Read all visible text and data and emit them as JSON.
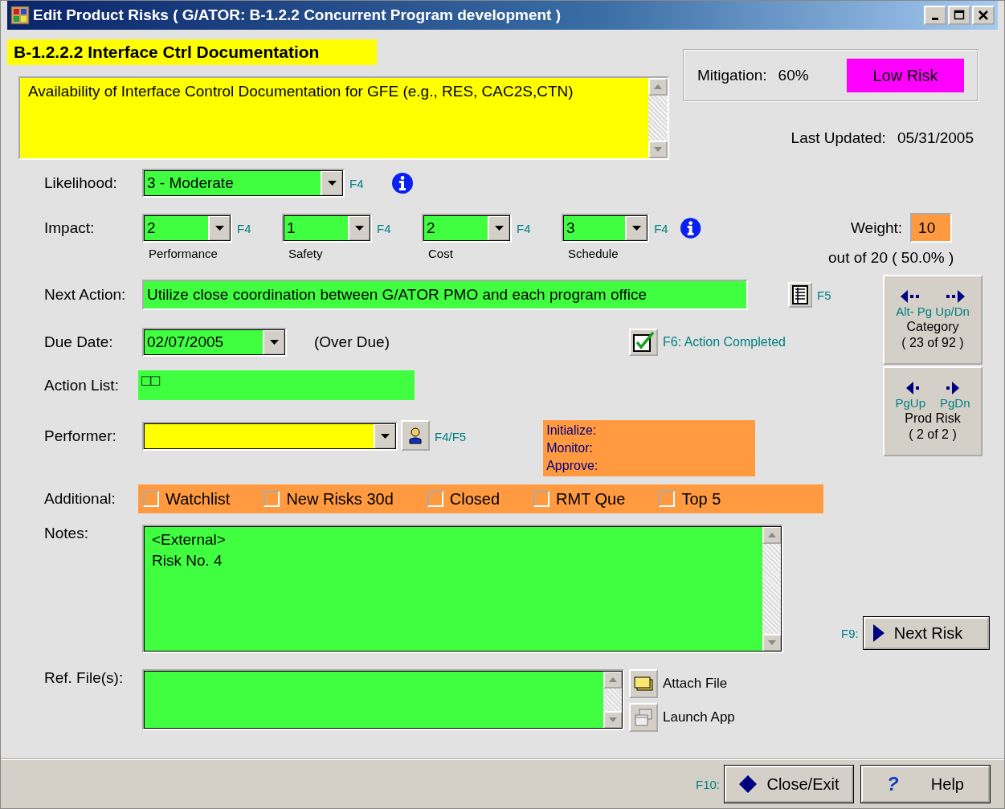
{
  "window": {
    "title": "Edit Product Risks  ( G/ATOR:  B-1.2.2 Concurrent Program development )"
  },
  "heading": "B-1.2.2.2 Interface Ctrl Documentation",
  "description": "Availability of Interface Control Documentation for GFE (e.g., RES, CAC2S,CTN)",
  "mitigation": {
    "label": "Mitigation:",
    "value": "60%",
    "risk": "Low Risk"
  },
  "last_updated": {
    "label": "Last Updated:",
    "value": "05/31/2005"
  },
  "likelihood": {
    "label": "Likelihood:",
    "value": "3 - Moderate",
    "key": "F4"
  },
  "impact": {
    "label": "Impact:",
    "items": [
      {
        "value": "2",
        "key": "F4",
        "caption": "Performance"
      },
      {
        "value": "1",
        "key": "F4",
        "caption": "Safety"
      },
      {
        "value": "2",
        "key": "F4",
        "caption": "Cost"
      },
      {
        "value": "3",
        "key": "F4",
        "caption": "Schedule"
      }
    ]
  },
  "weight": {
    "label": "Weight:",
    "value": "10",
    "out_of": "out of  20  ( 50.0% )"
  },
  "next_action": {
    "label": "Next Action:",
    "value": "Utilize close coordination between G/ATOR PMO and each program office",
    "key": "F5"
  },
  "due_date": {
    "label": "Due Date:",
    "value": "02/07/2005",
    "status": "(Over Due)"
  },
  "action_completed": {
    "label": "F6: Action Completed",
    "checked": true
  },
  "action_list": {
    "label": "Action List:",
    "value": "□□"
  },
  "performer": {
    "label": "Performer:",
    "key": "F4/F5"
  },
  "roles": [
    "Initialize:",
    "Monitor:",
    "Approve:"
  ],
  "additional": {
    "label": "Additional:",
    "options": [
      {
        "label": "Watchlist",
        "checked": false
      },
      {
        "label": "New Risks 30d",
        "checked": false
      },
      {
        "label": "Closed",
        "checked": false
      },
      {
        "label": "RMT Que",
        "checked": false
      },
      {
        "label": "Top 5",
        "checked": false
      }
    ]
  },
  "notes": {
    "label": "Notes:",
    "lines": [
      "<External>",
      "Risk No. 4"
    ]
  },
  "ref_files": {
    "label": "Ref. File(s):"
  },
  "file_actions": [
    {
      "kind": "attach",
      "label": "Attach File"
    },
    {
      "kind": "launch",
      "label": "Launch App"
    }
  ],
  "navigation": [
    {
      "hints": [
        "Alt- Pg Up/Dn"
      ],
      "label": "Category",
      "count": "( 23 of 92 )"
    },
    {
      "hints": [
        "PgUp",
        "PgDn"
      ],
      "label": "Prod Risk",
      "count": "( 2 of 2 )"
    }
  ],
  "next_risk": {
    "key": "F9:",
    "label": "Next Risk"
  },
  "footer": {
    "key": "F10:",
    "buttons": [
      {
        "kind": "close",
        "label": "Close/Exit"
      },
      {
        "kind": "help",
        "icon": "?",
        "label": "Help"
      }
    ]
  }
}
